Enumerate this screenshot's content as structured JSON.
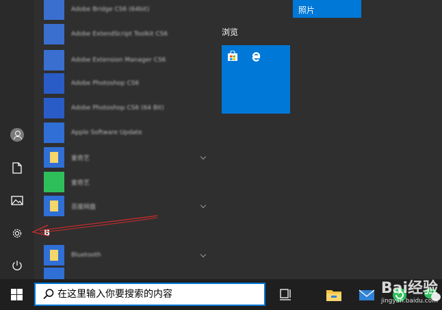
{
  "start_menu": {
    "rail": {
      "items": [
        {
          "name": "user-account",
          "icon": "user-icon"
        },
        {
          "name": "documents",
          "icon": "document-icon"
        },
        {
          "name": "pictures",
          "icon": "picture-icon"
        },
        {
          "name": "settings",
          "icon": "gear-icon"
        },
        {
          "name": "power",
          "icon": "power-icon"
        }
      ]
    },
    "app_list": {
      "apps": [
        {
          "label": "Adobe Bridge CS6 (64bit)",
          "icon_color": "#3a6fd0",
          "expandable": false
        },
        {
          "label": "Adobe ExtendScript Toolkit CS6",
          "icon_color": "#3a6fd0",
          "expandable": false
        },
        {
          "label": "Adobe Extension Manager CS6",
          "icon_color": "#3a6fd0",
          "expandable": false
        },
        {
          "label": "Adobe Photoshop CS6",
          "icon_color": "#2a5cc7",
          "expandable": false
        },
        {
          "label": "Adobe Photoshop CS6 (64 Bit)",
          "icon_color": "#2a5cc7",
          "expandable": false
        },
        {
          "label": "Apple Software Update",
          "icon_color": "#2f6fd6",
          "expandable": false
        },
        {
          "label": "爱奇艺",
          "icon_color": "#2f6fd6",
          "expandable": true
        },
        {
          "label": "爱奇艺",
          "icon_color": "#2fbf5a",
          "expandable": false
        },
        {
          "label": "百度网盘",
          "icon_color": "#2f6fd6",
          "expandable": true
        },
        {
          "label": "Bluetooth",
          "icon_color": "#2f6fd6",
          "expandable": true
        },
        {
          "label": "",
          "icon_color": "#2f6fd6",
          "expandable": false
        }
      ],
      "section_letter": "B"
    },
    "tiles": {
      "group_label": "浏览",
      "photos_label": "照片",
      "browse_tile_icons": [
        "store-icon",
        "edge-icon"
      ],
      "accent": "#0078d7"
    }
  },
  "taskbar": {
    "search_placeholder": "在这里输入你要搜索的内容",
    "icons": [
      "start-icon",
      "search-icon",
      "task-view-icon",
      "file-explorer-icon",
      "mail-icon",
      "refresh-app-icon",
      "wechat-icon"
    ]
  },
  "watermark": {
    "brand": "Bai经验",
    "url": "jingyan.baidu.com"
  }
}
